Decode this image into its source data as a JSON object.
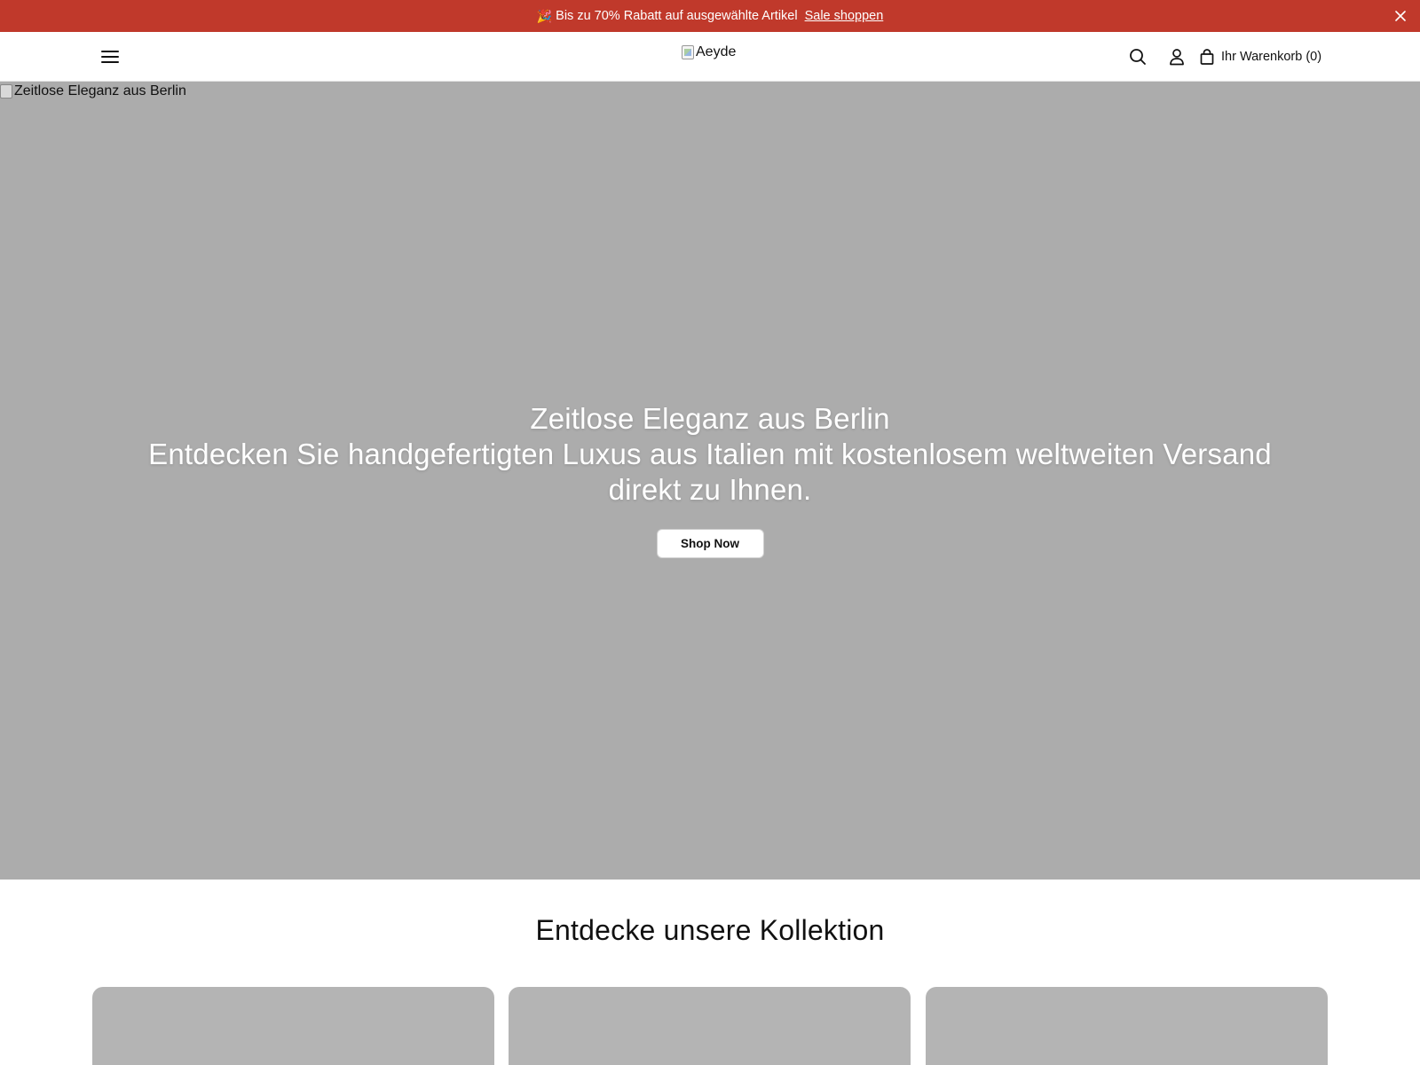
{
  "announcement": {
    "emoji": "🎉",
    "text": "Bis zu 70% Rabatt auf ausgewählte Artikel",
    "link": "Sale shoppen",
    "background": "#c0392b"
  },
  "header": {
    "logo_alt": "Aeyde",
    "cart_label": "Ihr Warenkorb (0)",
    "icons": [
      "hamburger-menu-icon",
      "search-icon",
      "user-icon",
      "shopping-bag-icon"
    ]
  },
  "hero": {
    "image_alt": "Zeitlose Eleganz aus Berlin",
    "title": "Zeitlose Eleganz aus Berlin",
    "subtitle": "Entdecken Sie handgefertigten Luxus aus Italien mit kostenlosem weltweiten Versand direkt zu Ihnen.",
    "cta": "Shop Now",
    "background": "#acacac"
  },
  "collection": {
    "title": "Entdecke unsere Kollektion"
  }
}
